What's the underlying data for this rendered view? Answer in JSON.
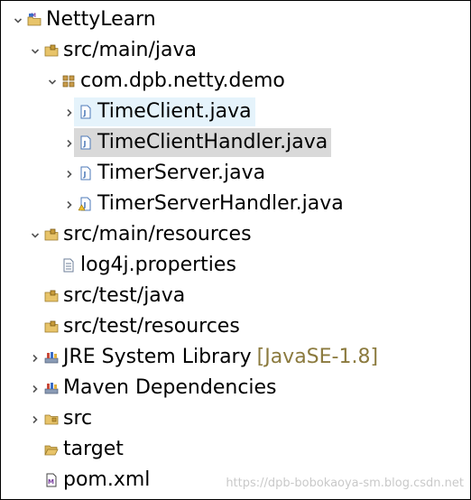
{
  "project_explorer": {
    "items": [
      {
        "label": "NettyLearn",
        "icon": "maven-project-icon",
        "toggle": "expanded",
        "depth": 0
      },
      {
        "label": "src/main/java",
        "icon": "source-folder-icon",
        "toggle": "expanded",
        "depth": 1
      },
      {
        "label": "com.dpb.netty.demo",
        "icon": "package-icon",
        "toggle": "expanded",
        "depth": 2
      },
      {
        "label": "TimeClient.java",
        "icon": "java-file-icon",
        "toggle": "collapsed",
        "depth": 3,
        "state": "hover"
      },
      {
        "label": "TimeClientHandler.java",
        "icon": "java-file-icon",
        "toggle": "collapsed",
        "depth": 3,
        "state": "selected"
      },
      {
        "label": "TimerServer.java",
        "icon": "java-file-icon",
        "toggle": "collapsed",
        "depth": 3
      },
      {
        "label": "TimerServerHandler.java",
        "icon": "java-file-warning-icon",
        "toggle": "collapsed",
        "depth": 3
      },
      {
        "label": "src/main/resources",
        "icon": "source-folder-icon",
        "toggle": "expanded",
        "depth": 1
      },
      {
        "label": "log4j.properties",
        "icon": "properties-file-icon",
        "toggle": "none",
        "depth": 2
      },
      {
        "label": "src/test/java",
        "icon": "source-folder-icon",
        "toggle": "none",
        "depth": 1
      },
      {
        "label": "src/test/resources",
        "icon": "source-folder-icon",
        "toggle": "none",
        "depth": 1
      },
      {
        "label": "JRE System Library",
        "decoration": "[JavaSE-1.8]",
        "icon": "library-icon",
        "toggle": "collapsed",
        "depth": 1
      },
      {
        "label": "Maven Dependencies",
        "icon": "library-icon",
        "toggle": "collapsed",
        "depth": 1
      },
      {
        "label": "src",
        "icon": "folder-icon",
        "toggle": "collapsed",
        "depth": 1
      },
      {
        "label": "target",
        "icon": "folder-open-icon",
        "toggle": "none",
        "depth": 1
      },
      {
        "label": "pom.xml",
        "icon": "maven-pom-icon",
        "toggle": "none",
        "depth": 1
      }
    ]
  },
  "watermark": "https://dpb-bobokaoya-sm.blog.csdn.net",
  "colors": {
    "hover": "#e5f3fb",
    "selected": "#d9d9d9",
    "decoration": "#8b7a3e",
    "folder": "#e8c46a",
    "java_file": "#4d79b8"
  }
}
